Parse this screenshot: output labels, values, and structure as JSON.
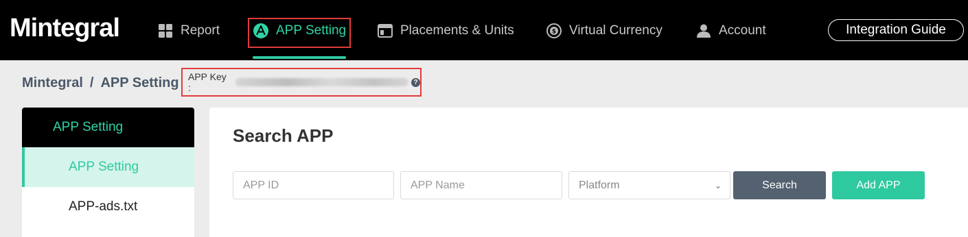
{
  "brand": "Mintegral",
  "nav": {
    "items": [
      {
        "label": "Report",
        "icon": "grid-icon"
      },
      {
        "label": "APP Setting",
        "icon": "app-store-icon",
        "active": true
      },
      {
        "label": "Placements & Units",
        "icon": "window-icon"
      },
      {
        "label": "Virtual Currency",
        "icon": "currency-icon"
      },
      {
        "label": "Account",
        "icon": "user-icon"
      }
    ],
    "guide_button": "Integration Guide"
  },
  "breadcrumb": {
    "root": "Mintegral",
    "separator": "/",
    "current": "APP Setting"
  },
  "app_key": {
    "label": "APP Key :",
    "help_icon": "?"
  },
  "sidebar": {
    "header": "APP Setting",
    "items": [
      {
        "label": "APP Setting",
        "active": true
      },
      {
        "label": "APP-ads.txt"
      }
    ]
  },
  "main": {
    "title": "Search APP",
    "app_id_placeholder": "APP ID",
    "app_name_placeholder": "APP Name",
    "platform_placeholder": "Platform",
    "search_button": "Search",
    "add_button": "Add APP"
  },
  "colors": {
    "accent": "#2fc9a0",
    "highlight_border": "#e23b3b",
    "search_button": "#546170"
  }
}
